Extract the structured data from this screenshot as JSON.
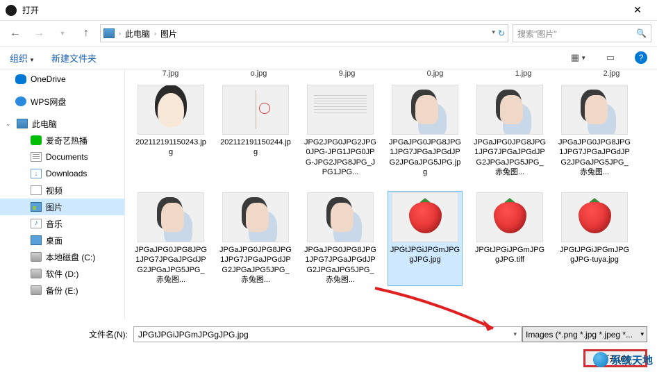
{
  "title": "打开",
  "breadcrumb": {
    "root": "此电脑",
    "folder": "图片"
  },
  "search_placeholder": "搜索\"图片\"",
  "toolbar": {
    "organize": "组织",
    "newfolder": "新建文件夹"
  },
  "sidebar": {
    "onedrive": "OneDrive",
    "wps": "WPS网盘",
    "thispc": "此电脑",
    "iqiyi": "爱奇艺热播",
    "documents": "Documents",
    "downloads": "Downloads",
    "videos": "视频",
    "pictures": "图片",
    "music": "音乐",
    "desktop": "桌面",
    "drive_c": "本地磁盘 (C:)",
    "drive_d": "软件 (D:)",
    "drive_e": "备份 (E:)"
  },
  "cutoff": [
    "7.jpg",
    "o.jpg",
    "9.jpg",
    "0.jpg",
    "1.jpg",
    "2.jpg"
  ],
  "files": [
    {
      "name": "202112191150243.jpg",
      "kind": "girl"
    },
    {
      "name": "202112191150244.jpg",
      "kind": "book"
    },
    {
      "name": "JPG2JPG0JPG2JPG0JPG-JPG1JPG0JPG-JPG2JPG8JPG_JPG1JPG...",
      "kind": "text"
    },
    {
      "name": "JPGaJPG0JPG8JPG1JPG7JPGaJPGdJPG2JPGaJPG5JPG.jpg",
      "kind": "boy"
    },
    {
      "name": "JPGaJPG0JPG8JPG1JPG7JPGaJPGdJPG2JPGaJPG5JPG_赤兔图...",
      "kind": "boy"
    },
    {
      "name": "JPGaJPG0JPG8JPG1JPG7JPGaJPGdJPG2JPGaJPG5JPG_赤兔图...",
      "kind": "boy"
    },
    {
      "name": "JPGaJPG0JPG8JPG1JPG7JPGaJPGdJPG2JPGaJPG5JPG_赤兔图...",
      "kind": "boy"
    },
    {
      "name": "JPGaJPG0JPG8JPG1JPG7JPGaJPGdJPG2JPGaJPG5JPG_赤兔图...",
      "kind": "boy"
    },
    {
      "name": "JPGaJPG0JPG8JPG1JPG7JPGaJPGdJPG2JPGaJPG5JPG_赤兔图...",
      "kind": "boy"
    },
    {
      "name": "JPGtJPGiJPGmJPGgJPG.jpg",
      "kind": "straw",
      "selected": true
    },
    {
      "name": "JPGtJPGiJPGmJPGgJPG.tiff",
      "kind": "straw"
    },
    {
      "name": "JPGtJPGiJPGmJPGgJPG-tuya.jpg",
      "kind": "straw"
    }
  ],
  "filename_label": "文件名(N):",
  "filename_value": "JPGtJPGiJPGmJPGgJPG.jpg",
  "filter": "Images (*.png *.jpg *.jpeg *...",
  "open_btn": "打开(O)",
  "watermark": "系统天地"
}
